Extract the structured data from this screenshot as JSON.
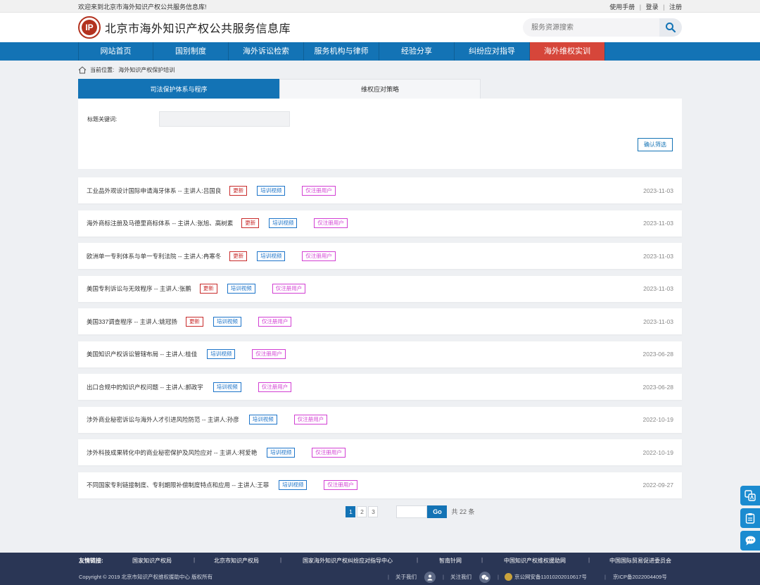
{
  "topbar": {
    "welcome": "欢迎来到北京市海外知识产权公共服务信息库!",
    "manual": "使用手册",
    "login": "登录",
    "register": "注册",
    "separator": "|"
  },
  "header": {
    "site_title": "北京市海外知识产权公共服务信息库",
    "search_placeholder": "服务资源搜索"
  },
  "nav": {
    "items": [
      "网站首页",
      "国别制度",
      "海外诉讼检索",
      "服务机构与律师",
      "经验分享",
      "纠纷应对指导",
      "海外维权实训"
    ],
    "active_index": 6
  },
  "breadcrumb": {
    "prefix": "当前位置:",
    "current": "海外知识产权保护培训"
  },
  "tabs": [
    "司法保护体系与程序",
    "维权应对策略"
  ],
  "filter": {
    "label": "标题关键词:",
    "confirm": "确认筛选"
  },
  "tags": {
    "new": "更新",
    "video": "培训视频",
    "registered": "仅注册用户"
  },
  "courses": [
    {
      "title": "工业品外观设计国际申请海牙体系 -- 主讲人:吕国良",
      "is_new": true,
      "date": "2023-11-03"
    },
    {
      "title": "海外商标注册及马德里商标体系 -- 主讲人:张旭、高树素",
      "is_new": true,
      "date": "2023-11-03"
    },
    {
      "title": "欧洲单一专利体系与单一专利法院 -- 主讲人:冉寒冬",
      "is_new": true,
      "date": "2023-11-03"
    },
    {
      "title": "美国专利诉讼与无效程序 -- 主讲人:张鹏",
      "is_new": true,
      "date": "2023-11-03"
    },
    {
      "title": "美国337调查程序 -- 主讲人:姚冠扬",
      "is_new": true,
      "date": "2023-11-03"
    },
    {
      "title": "美国知识产权诉讼管辖布局 -- 主讲人:桂佳",
      "is_new": false,
      "date": "2023-06-28"
    },
    {
      "title": "出口合规中的知识产权问题 -- 主讲人:郝政宇",
      "is_new": false,
      "date": "2023-06-28"
    },
    {
      "title": "涉外商业秘密诉讼与海外人才引进风险防范 -- 主讲人:孙彦",
      "is_new": false,
      "date": "2022-10-19"
    },
    {
      "title": "涉外科技成果转化中的商业秘密保护及风险应对 -- 主讲人:柯爱艳",
      "is_new": false,
      "date": "2022-10-19"
    },
    {
      "title": "不同国家专利链接制度、专利期限补偿制度特点和应用 -- 主讲人:王菲",
      "is_new": false,
      "date": "2022-09-27"
    }
  ],
  "pagination": {
    "pages": [
      "1",
      "2",
      "3"
    ],
    "current": "1",
    "go": "Go",
    "total": "共 22 条"
  },
  "footer": {
    "links_label": "友情链接:",
    "links": [
      "国家知识产权局",
      "北京市知识产权局",
      "国家海外知识产权纠纷应对指导中心",
      "智南针网",
      "中国知识产权维权援助网",
      "中国国际贸易促进委员会"
    ],
    "copyright": "Copyright © 2019 北京市知识产权维权援助中心 版权所有",
    "about": "关于我们",
    "follow": "关注我们",
    "police": "京公网安备11010202010617号",
    "icp": "京ICP备2022004409号"
  },
  "colors": {
    "primary": "#1373b5",
    "active_nav": "#d6463a",
    "footer": "#2a3655",
    "tag_new": "#c82a2a",
    "tag_video": "#1d74c9",
    "tag_registered": "#d23fd3"
  },
  "icons": {
    "logo": "ip-logo",
    "search": "search-icon",
    "home": "home-icon",
    "float_buttons": [
      "translate-icon",
      "clipboard-icon",
      "chat-icon"
    ],
    "footer": [
      "user-icon",
      "wechat-icon",
      "police-badge-icon"
    ]
  }
}
